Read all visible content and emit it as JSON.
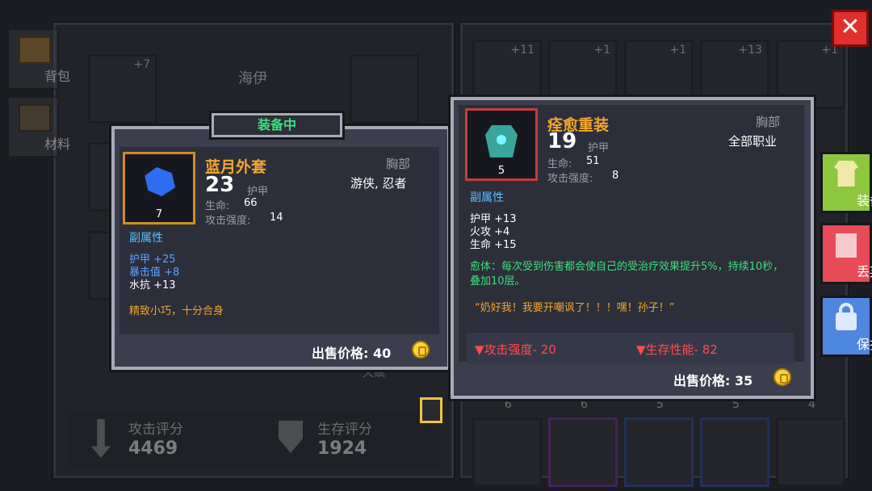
{
  "close_button": {
    "glyph": "✕"
  },
  "left_tabs": {
    "bag": "背包",
    "material": "材料"
  },
  "character": {
    "name": "海伊",
    "slot_counts": [
      "+7"
    ],
    "slot_nums": [
      "5",
      "7"
    ]
  },
  "stats": {
    "attack_label": "攻击评分",
    "attack_value": "4469",
    "survival_label": "生存评分",
    "survival_value": "1924"
  },
  "bottom_partial": [
    "天赋"
  ],
  "inventory": {
    "row1_counts": [
      "+11",
      "+1",
      "+1",
      "+13",
      "+1"
    ],
    "row2_nums": [
      "6",
      "6",
      "5",
      "5",
      "4"
    ]
  },
  "side_buttons": {
    "equip": "装备",
    "discard": "丢弃",
    "protect": "保护"
  },
  "equipped_card": {
    "badge": "装备中",
    "name": "蓝月外套",
    "level": "7",
    "armor_value": "23",
    "armor_label": "护甲",
    "slot": "胸部",
    "classes": "游侠, 忍者",
    "hp_label": "生命:",
    "hp_value": "66",
    "atk_label": "攻击强度:",
    "atk_value": "14",
    "sub_title": "副属性",
    "subs": [
      "护甲 +25",
      "暴击值 +8",
      "水抗 +13"
    ],
    "flavor": "精致小巧，十分合身",
    "price_label": "出售价格: 40"
  },
  "compare_card": {
    "name": "痊愈重装",
    "level": "5",
    "armor_value": "19",
    "armor_label": "护甲",
    "slot": "胸部",
    "classes": "全部职业",
    "hp_label": "生命:",
    "hp_value": "51",
    "atk_label": "攻击强度:",
    "atk_value": "8",
    "sub_title": "副属性",
    "subs": [
      "护甲 +13",
      "火攻 +4",
      "生命 +15"
    ],
    "effect": "愈体：每次受到伤害都会使自己的受治疗效果提升5%，持续10秒，叠加10层。",
    "quote": "“奶好我！我要开嘲讽了！！！嘿！孙子！”",
    "diff_atk": "▼攻击强度- 20",
    "diff_survival": "▼生存性能- 82",
    "price_label": "出售价格: 35"
  }
}
